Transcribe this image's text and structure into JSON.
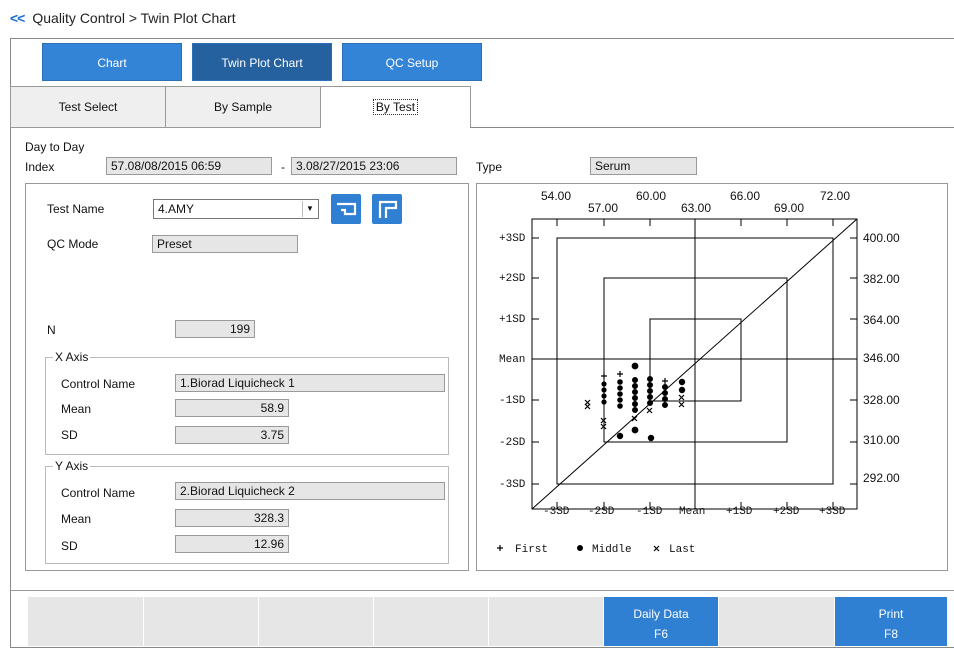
{
  "breadcrumb": {
    "back": "<<",
    "text": "Quality Control > Twin Plot Chart"
  },
  "top_buttons": {
    "chart": "Chart",
    "twin_plot": "Twin Plot Chart",
    "qc_setup": "QC Setup"
  },
  "tabs": {
    "test_select": "Test Select",
    "by_sample": "By Sample",
    "by_test": "By Test"
  },
  "filter": {
    "day_to_day": "Day to Day",
    "index_label": "Index",
    "index_from": "57.08/08/2015 06:59",
    "dash": "-",
    "index_to": "3.08/27/2015 23:06",
    "type_label": "Type",
    "type_value": "Serum"
  },
  "left": {
    "test_name_label": "Test Name",
    "test_name_value": "4.AMY",
    "qc_mode_label": "QC Mode",
    "qc_mode_value": "Preset",
    "n_label": "N",
    "n_value": "199",
    "x_axis": {
      "title": "X Axis",
      "control_name_label": "Control Name",
      "control_name": "1.Biorad Liquicheck 1",
      "mean_label": "Mean",
      "mean": "58.9",
      "sd_label": "SD",
      "sd": "3.75"
    },
    "y_axis": {
      "title": "Y Axis",
      "control_name_label": "Control Name",
      "control_name": "2.Biorad Liquicheck 2",
      "mean_label": "Mean",
      "mean": "328.3",
      "sd_label": "SD",
      "sd": "12.96"
    }
  },
  "plot": {
    "top_ticks_upper": [
      "54.00",
      "60.00",
      "66.00",
      "72.00"
    ],
    "top_ticks_lower": [
      "57.00",
      "63.00",
      "69.00"
    ],
    "left_ticks": [
      "+3SD",
      "+2SD",
      "+1SD",
      "Mean",
      "-1SD",
      "-2SD",
      "-3SD"
    ],
    "right_ticks": [
      "400.00",
      "382.00",
      "364.00",
      "346.00",
      "328.00",
      "310.00",
      "292.00"
    ],
    "bottom_ticks": [
      "-3SD",
      "-2SD",
      "-1SD",
      "Mean",
      "+1SD",
      "+2SD",
      "+3SD"
    ],
    "legend": {
      "first": "First",
      "middle": "Middle",
      "last": "Last"
    }
  },
  "bottom": {
    "daily_data": "Daily Data",
    "daily_key": "F6",
    "print": "Print",
    "print_key": "F8"
  }
}
